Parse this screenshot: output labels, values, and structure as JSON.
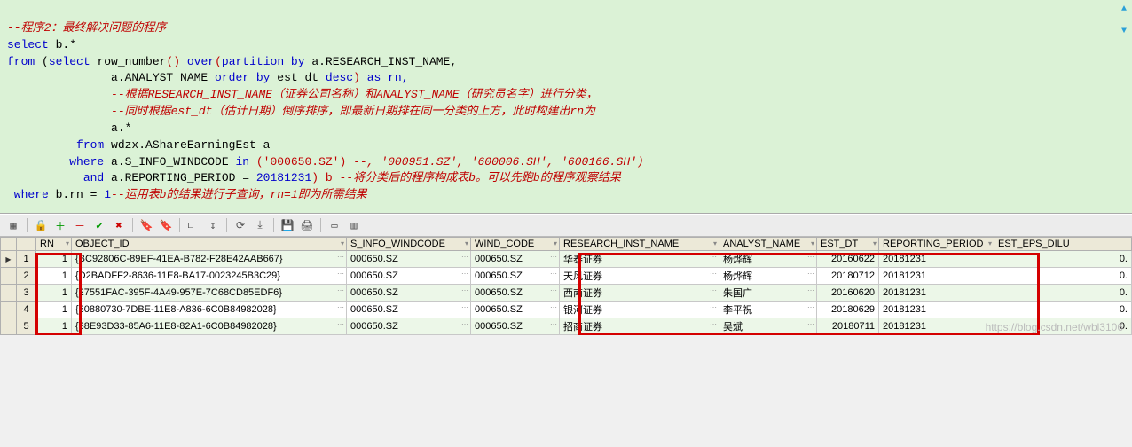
{
  "code": {
    "c1": "--程序2：最终解决问题的程序",
    "select": "select",
    "b_star": " b.*",
    "from1": "from",
    "open_paren": " (",
    "select2": "select",
    "rownum": " row_number",
    "over": " over",
    "part": "partition by",
    "col1": " a.RESEARCH_INST_NAME,",
    "col2": "               a.ANALYST_NAME ",
    "orderby": "order by",
    "estdt": " est_dt ",
    "desc": "desc",
    "asrn": " as rn,",
    "c2": "               --根据RESEARCH_INST_NAME（证券公司名称）和ANALYST_NAME（研究员名字）进行分类，",
    "c3": "               --同时根据est_dt（估计日期）倒序排序，即最新日期排在同一分类的上方，此时构建出rn为",
    "astar": "               a.*",
    "from2": "          from",
    "tbl": " wdzx.AShareEarningEst a",
    "where1": "         where",
    "winfo": " a.S_INFO_WINDCODE ",
    "in": "in",
    "pstr": " ('000650.SZ')",
    "c4": " --, '000951.SZ', '600006.SH', '600166.SH')",
    "and": "           and",
    "rp": " a.REPORTING_PERIOD = ",
    "rpval": "20181231",
    "sub_b": ") b ",
    "c5": "--将分类后的程序构成表b。可以先跑b的程序观察结果",
    "where2": " where",
    "brn": " b.rn = ",
    "one": "1",
    "c6": "--运用表b的结果进行子查询，rn=1即为所需结果"
  },
  "grid": {
    "columns": [
      "RN",
      "OBJECT_ID",
      "S_INFO_WINDCODE",
      "WIND_CODE",
      "RESEARCH_INST_NAME",
      "ANALYST_NAME",
      "EST_DT",
      "REPORTING_PERIOD",
      "EST_EPS_DILU"
    ],
    "rows": [
      {
        "n": "1",
        "rn": "1",
        "obj": "{BC92806C-89EF-41EA-B782-F28E42AAB667}",
        "s": "000650.SZ",
        "w": "000650.SZ",
        "inst": "华泰证券",
        "an": "杨烨辉",
        "dt": "20160622",
        "rp": "20181231",
        "eps": "0."
      },
      {
        "n": "2",
        "rn": "1",
        "obj": "{D2BADFF2-8636-11E8-BA17-0023245B3C29}",
        "s": "000650.SZ",
        "w": "000650.SZ",
        "inst": "天风证券",
        "an": "杨烨辉",
        "dt": "20180712",
        "rp": "20181231",
        "eps": "0."
      },
      {
        "n": "3",
        "rn": "1",
        "obj": "{27551FAC-395F-4A49-957E-7C68CD85EDF6}",
        "s": "000650.SZ",
        "w": "000650.SZ",
        "inst": "西南证券",
        "an": "朱国广",
        "dt": "20160620",
        "rp": "20181231",
        "eps": "0."
      },
      {
        "n": "4",
        "rn": "1",
        "obj": "{80880730-7DBE-11E8-A836-6C0B84982028}",
        "s": "000650.SZ",
        "w": "000650.SZ",
        "inst": "银河证券",
        "an": "李平祝",
        "dt": "20180629",
        "rp": "20181231",
        "eps": "0."
      },
      {
        "n": "5",
        "rn": "1",
        "obj": "{38E93D33-85A6-11E8-82A1-6C0B84982028}",
        "s": "000650.SZ",
        "w": "000650.SZ",
        "inst": "招商证券",
        "an": "吴斌",
        "dt": "20180711",
        "rp": "20181231",
        "eps": "0."
      }
    ]
  },
  "watermark": "https://blog.csdn.net/wbl3106"
}
